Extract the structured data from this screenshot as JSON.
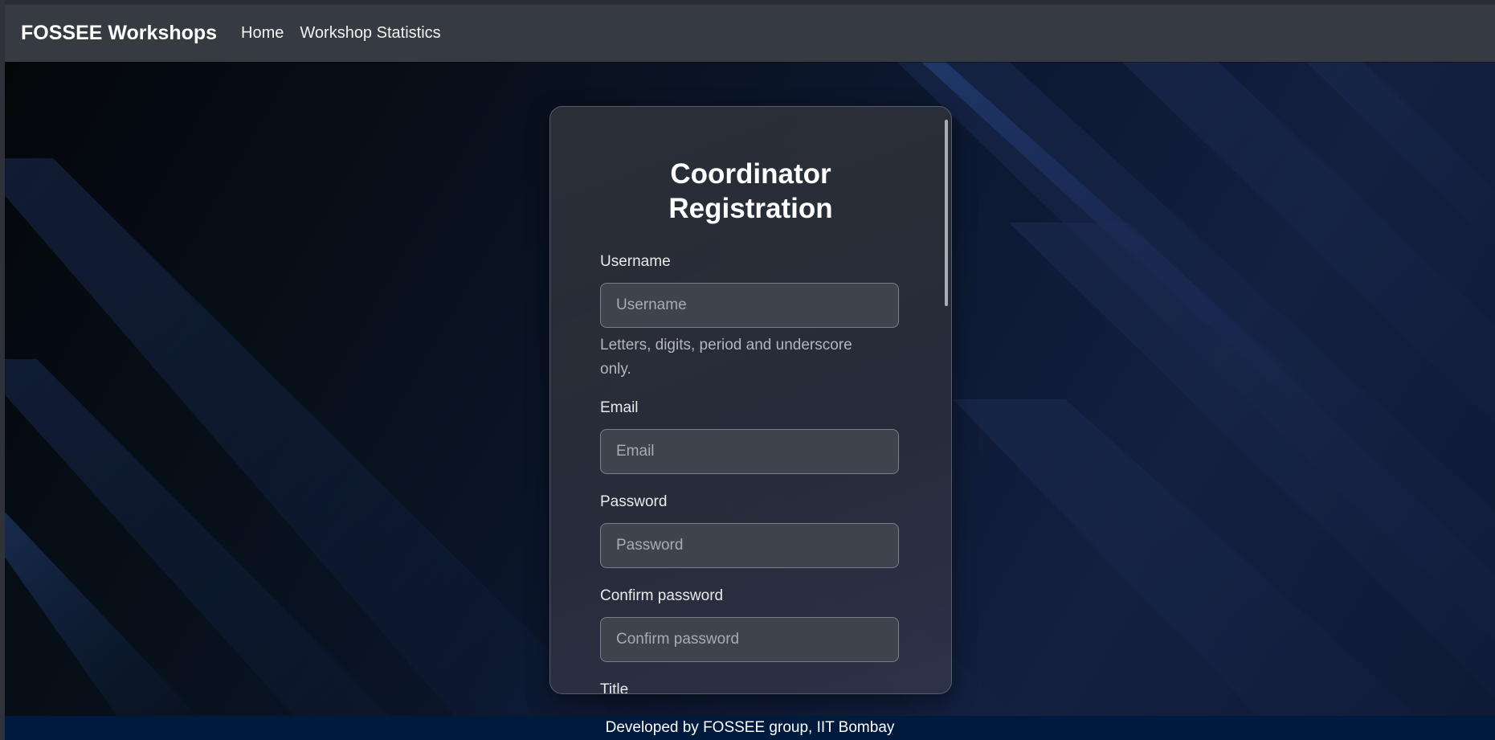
{
  "navbar": {
    "brand": "FOSSEE Workshops",
    "links": [
      {
        "label": "Home"
      },
      {
        "label": "Workshop Statistics"
      }
    ]
  },
  "form": {
    "title_line1": "Coordinator",
    "title_line2": "Registration",
    "fields": {
      "username": {
        "label": "Username",
        "placeholder": "Username",
        "help": "Letters, digits, period and underscore only."
      },
      "email": {
        "label": "Email",
        "placeholder": "Email"
      },
      "password": {
        "label": "Password",
        "placeholder": "Password"
      },
      "confirm_password": {
        "label": "Confirm password",
        "placeholder": "Confirm password"
      },
      "title": {
        "label": "Title"
      }
    }
  },
  "footer": {
    "text": "Developed by FOSSEE group, IIT Bombay"
  },
  "colors": {
    "navbar": "#363a41",
    "footer": "#001a3d",
    "card": "#2c3038",
    "input": "#3f434e"
  }
}
